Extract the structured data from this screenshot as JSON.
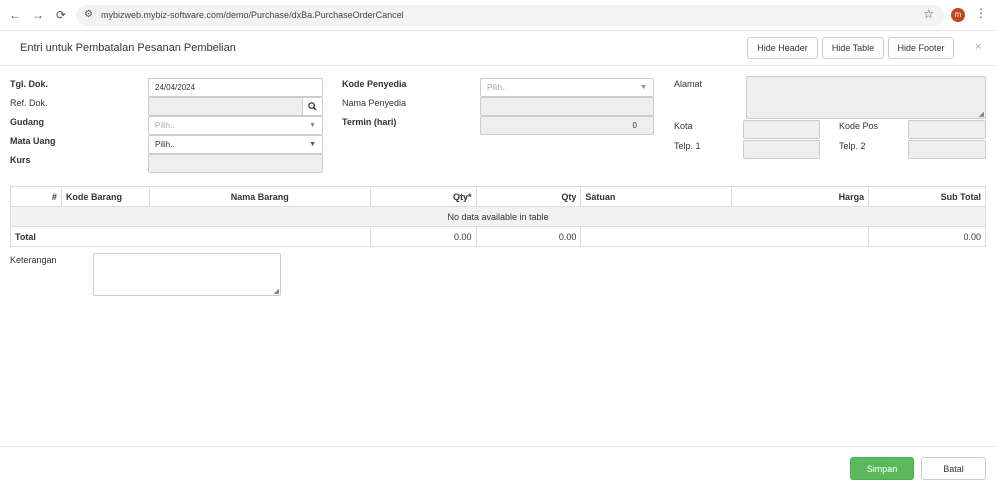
{
  "browser": {
    "back_icon": "←",
    "forward_icon": "→",
    "reload_icon": "⟳",
    "site_icon": "⚙",
    "url": "mybizweb.mybiz-software.com/demo/Purchase/dxBa.PurchaseOrderCancel",
    "star_icon": "☆",
    "avatar_letter": "m",
    "menu_icon": "⋮"
  },
  "modal": {
    "title": "Entri untuk Pembatalan Pesanan Pembelian",
    "hide_header": "Hide Header",
    "hide_table": "Hide Table",
    "hide_footer": "Hide Footer",
    "close": "×"
  },
  "form": {
    "tgl_dok_label": "Tgl. Dok.",
    "tgl_dok_value": "24/04/2024",
    "ref_dok_label": "Ref. Dok.",
    "search_icon": "🔍",
    "gudang_label": "Gudang",
    "gudang_placeholder": "Pilih..",
    "mata_uang_label": "Mata Uang",
    "mata_uang_value": "Pilih..",
    "kurs_label": "Kurs",
    "kode_penyedia_label": "Kode Penyedia",
    "kode_penyedia_placeholder": "Pilih..",
    "nama_penyedia_label": "Nama Penyedia",
    "termin_label": "Termin (hari)",
    "termin_value": "0",
    "alamat_label": "Alamat",
    "kota_label": "Kota",
    "kode_pos_label": "Kode Pos",
    "telp1_label": "Telp. 1",
    "telp2_label": "Telp. 2",
    "dropdown_caret": "▼"
  },
  "table": {
    "headers": [
      "#",
      "Kode Barang",
      "Nama Barang",
      "Qty*",
      "Qty",
      "Satuan",
      "Harga",
      "Sub Total"
    ],
    "empty_message": "No data available in table",
    "total_label": "Total",
    "total_qty_star": "0.00",
    "total_qty": "0.00",
    "total_subtotal": "0.00"
  },
  "keterangan_label": "Keterangan",
  "footer": {
    "save": "Simpan",
    "cancel": "Batal"
  }
}
